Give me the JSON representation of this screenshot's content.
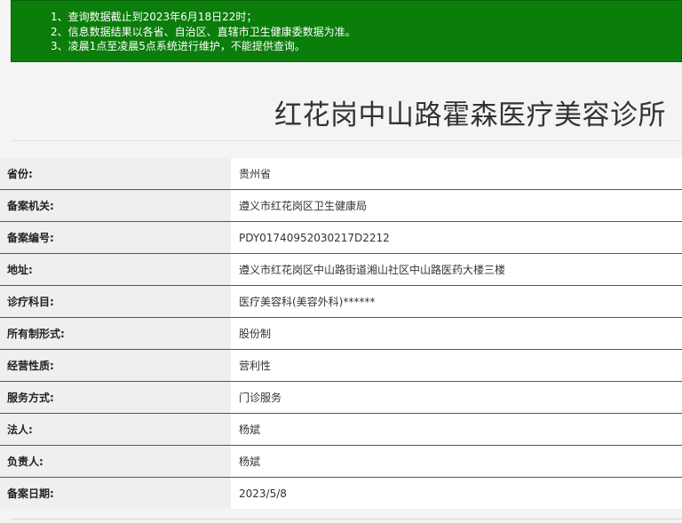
{
  "notice": {
    "lines": [
      "1、查询数据截止到2023年6月18日22时；",
      "2、信息数据结果以各省、自治区、直辖市卫生健康委数据为准。",
      "3、凌晨1点至凌晨5点系统进行维护，不能提供查询。"
    ]
  },
  "page_title": "红花岗中山路霍森医疗美容诊所",
  "rows": [
    {
      "label": "省份:",
      "value": "贵州省"
    },
    {
      "label": "备案机关:",
      "value": "遵义市红花岗区卫生健康局"
    },
    {
      "label": "备案编号:",
      "value": "PDY01740952030217D2212"
    },
    {
      "label": "地址:",
      "value": "遵义市红花岗区中山路街道湘山社区中山路医药大楼三楼"
    },
    {
      "label": "诊疗科目:",
      "value": "医疗美容科(美容外科)******"
    },
    {
      "label": "所有制形式:",
      "value": "股份制"
    },
    {
      "label": "经营性质:",
      "value": "营利性"
    },
    {
      "label": "服务方式:",
      "value": "门诊服务"
    },
    {
      "label": "法人:",
      "value": "杨斌"
    },
    {
      "label": "负责人:",
      "value": "杨斌"
    },
    {
      "label": "备案日期:",
      "value": "2023/5/8"
    }
  ]
}
